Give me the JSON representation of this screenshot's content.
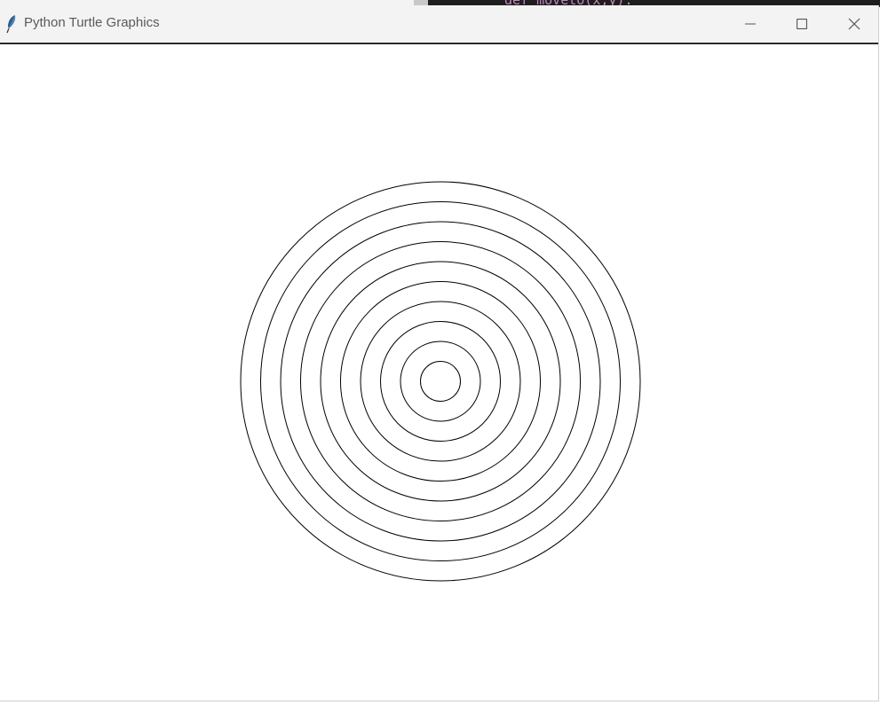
{
  "window": {
    "title": "Python Turtle Graphics",
    "icon": "feather-icon"
  },
  "controls": {
    "minimize_icon": "minimize-icon",
    "maximize_icon": "maximize-icon",
    "close_icon": "close-icon"
  },
  "background": {
    "code_fragment": "def moveto(x,y):"
  },
  "drawing": {
    "shape": "concentric circles",
    "ring_count": 10,
    "radii_units": [
      25,
      50,
      75,
      100,
      125,
      150,
      175,
      200,
      225,
      250
    ],
    "pen_color": "#000000",
    "canvas_color": "#ffffff"
  }
}
